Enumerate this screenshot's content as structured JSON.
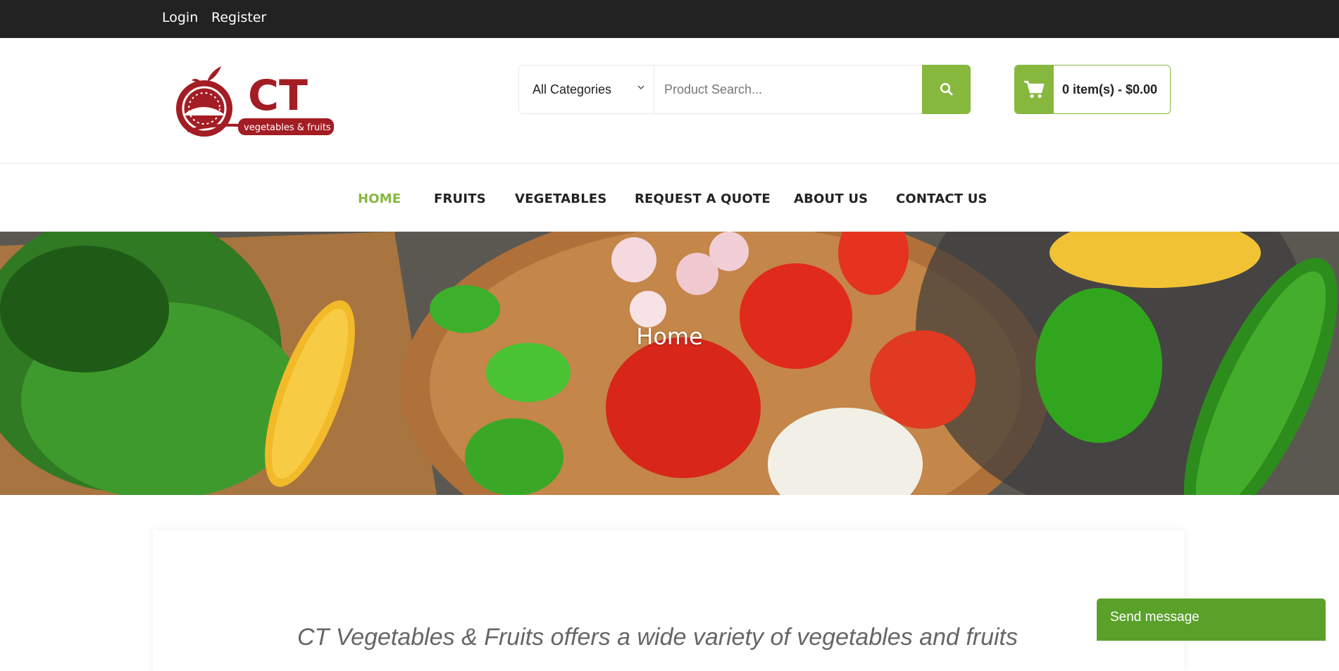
{
  "topbar": {
    "login": "Login",
    "register": "Register"
  },
  "logo": {
    "brand": "CT",
    "tagline": "vegetables & fruits"
  },
  "search": {
    "category": "All Categories",
    "placeholder": "Product Search...",
    "button_icon": "search-icon"
  },
  "cart": {
    "summary": "0 item(s) - $0.00",
    "icon": "cart-icon"
  },
  "nav": {
    "items": [
      {
        "label": "HOME",
        "active": true
      },
      {
        "label": "FRUITS"
      },
      {
        "label": "VEGETABLES"
      },
      {
        "label": "REQUEST A QUOTE"
      },
      {
        "label": "ABOUT US"
      },
      {
        "label": "CONTACT US"
      }
    ]
  },
  "hero": {
    "title": "Home"
  },
  "content": {
    "intro": "CT Vegetables & Fruits offers a wide variety of vegetables and fruits"
  },
  "chat": {
    "label": "Send message"
  },
  "colors": {
    "accent": "#86b83e",
    "topbar": "#222222",
    "brand_red": "#a31d24",
    "chat": "#5aa12a"
  }
}
